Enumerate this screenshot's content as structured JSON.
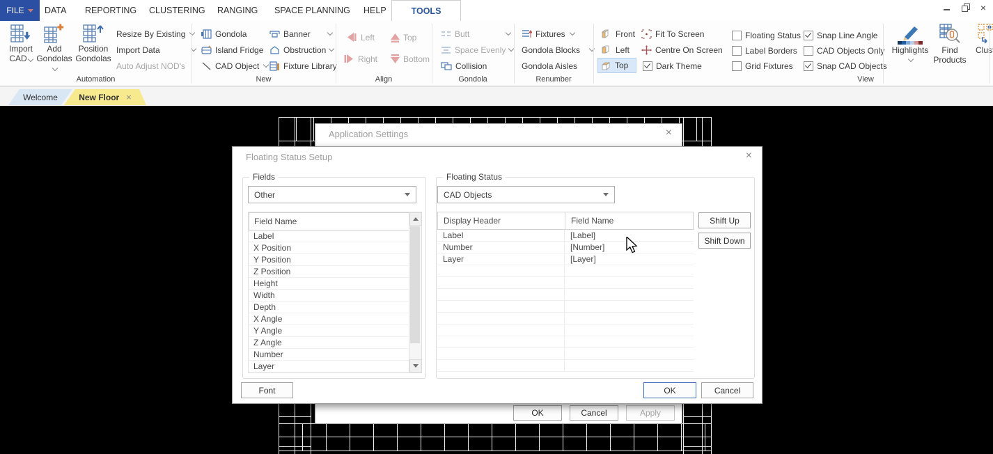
{
  "window": {
    "close_glyph": "×"
  },
  "menubar": {
    "file_label": "FILE",
    "items": [
      "DATA",
      "REPORTING",
      "CLUSTERING",
      "RANGING",
      "SPACE PLANNING",
      "HELP"
    ],
    "active_tab": "TOOLS"
  },
  "ribbon": {
    "group_labels": [
      "Automation",
      "New",
      "Align",
      "Gondola",
      "Renumber",
      "View"
    ],
    "automation": {
      "big": [
        {
          "l1": "Import",
          "l2": "CAD"
        },
        {
          "l1": "Add",
          "l2": "Gondolas"
        },
        {
          "l1": "Position",
          "l2": "Gondolas"
        }
      ],
      "menu": [
        {
          "label": "Resize By Existing"
        },
        {
          "label": "Import Data"
        },
        {
          "label": "Auto Adjust NOD's"
        }
      ]
    },
    "new": {
      "col1": [
        {
          "label": "Gondola"
        },
        {
          "label": "Island Fridge"
        },
        {
          "label": "CAD Object"
        }
      ],
      "col2": [
        {
          "label": "Banner"
        },
        {
          "label": "Obstruction"
        },
        {
          "label": "Fixture Library"
        }
      ]
    },
    "align": {
      "col1": [
        {
          "label": "Left"
        },
        {
          "label": "Right"
        }
      ],
      "col2": [
        {
          "label": "Top"
        },
        {
          "label": "Bottom"
        }
      ]
    },
    "gondola": {
      "items": [
        {
          "label": "Butt"
        },
        {
          "label": "Space Evenly"
        },
        {
          "label": "Collision"
        }
      ]
    },
    "renumber": {
      "items": [
        {
          "label": "Fixtures"
        },
        {
          "label": "Gondola Blocks"
        },
        {
          "label": "Gondola Aisles"
        }
      ]
    },
    "view": {
      "faces": [
        {
          "label": "Front"
        },
        {
          "label": "Left"
        },
        {
          "label": "Top",
          "selected": true
        }
      ],
      "screen": [
        {
          "label": "Fit To Screen"
        },
        {
          "label": "Centre On Screen"
        },
        {
          "label": "Dark Theme",
          "checked": true
        }
      ],
      "checks1": [
        {
          "label": "Floating Status",
          "checked": false
        },
        {
          "label": "Label Borders",
          "checked": false
        },
        {
          "label": "Grid Fixtures",
          "checked": false
        }
      ],
      "checks2": [
        {
          "label": "Snap Line Angle",
          "checked": true
        },
        {
          "label": "CAD Objects Only",
          "checked": false
        },
        {
          "label": "Snap CAD Objects",
          "checked": true
        }
      ]
    },
    "tools_right": {
      "highlights": "Highlights",
      "find_l1": "Find",
      "find_l2": "Products",
      "cluster": "Cluster"
    }
  },
  "doc_tabs": [
    {
      "label": "Welcome",
      "active": false
    },
    {
      "label": "New Floor",
      "active": true,
      "close": "×"
    }
  ],
  "app_settings_dialog": {
    "title": "Application Settings",
    "close": "×",
    "ok": "OK",
    "cancel": "Cancel",
    "apply": "Apply"
  },
  "floating_dialog": {
    "title": "Floating Status Setup",
    "close": "×",
    "fields": {
      "legend": "Fields",
      "dropdown": "Other",
      "header": "Field Name",
      "items": [
        "Label",
        "X Position",
        "Y Position",
        "Z Position",
        "Height",
        "Width",
        "Depth",
        "X Angle",
        "Y Angle",
        "Z Angle",
        "Number",
        "Layer"
      ]
    },
    "status": {
      "legend": "Floating Status",
      "dropdown": "CAD Objects",
      "col1": "Display Header",
      "col2": "Field Name",
      "rows": [
        {
          "header": "Label",
          "field": "[Label]"
        },
        {
          "header": "Number",
          "field": "[Number]"
        },
        {
          "header": "Layer",
          "field": "[Layer]"
        }
      ],
      "empty_rows": 9
    },
    "shift_up": "Shift Up",
    "shift_down": "Shift Down",
    "font": "Font",
    "ok": "OK",
    "cancel": "Cancel"
  },
  "colors": {
    "file_button": "#2b4fa2",
    "tools_tab_text": "#2b579a",
    "active_doc_tab": "#f7e98e",
    "inactive_doc_tab": "#d9e7f5",
    "selected_ribbon_button": "#d8e8f8",
    "canvas_background": "#000000",
    "floorplan_lines": "#ededed",
    "default_button_border": "#3e6db5"
  }
}
